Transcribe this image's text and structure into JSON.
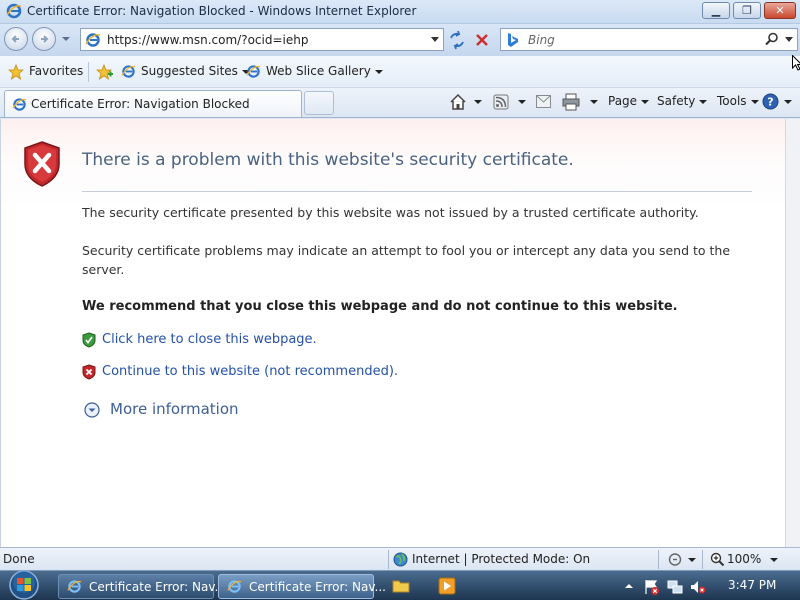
{
  "window": {
    "title": "Certificate Error: Navigation Blocked - Windows Internet Explorer"
  },
  "address_bar": {
    "url": "https://www.msn.com/?ocid=iehp",
    "search_placeholder": "Bing"
  },
  "favorites_bar": {
    "favorites_label": "Favorites",
    "items": [
      "Suggested Sites",
      "Web Slice Gallery"
    ]
  },
  "tabs": {
    "active_label": "Certificate Error: Navigation Blocked"
  },
  "command_bar": {
    "page": "Page",
    "safety": "Safety",
    "tools": "Tools"
  },
  "content": {
    "headline": "There is a problem with this website's security certificate.",
    "paragraph1": "The security certificate presented by this website was not issued by a trusted certificate authority.",
    "paragraph2": "Security certificate problems may indicate an attempt to fool you or intercept any data you send to the server.",
    "recommendation": "We recommend that you close this webpage and do not continue to this website.",
    "close_link": "Click here to close this webpage.",
    "continue_link": "Continue to this website (not recommended).",
    "more_info": "More information"
  },
  "status_bar": {
    "status": "Done",
    "zone": "Internet | Protected Mode: On",
    "zoom": "100%"
  },
  "taskbar": {
    "tasks": [
      "Certificate Error: Nav...",
      "Certificate Error: Nav..."
    ],
    "clock": "3:47 PM"
  },
  "colors": {
    "link": "#2451a8",
    "headline": "#4a6281",
    "shield_red": "#c0282c",
    "shield_green": "#3a9b3a"
  }
}
